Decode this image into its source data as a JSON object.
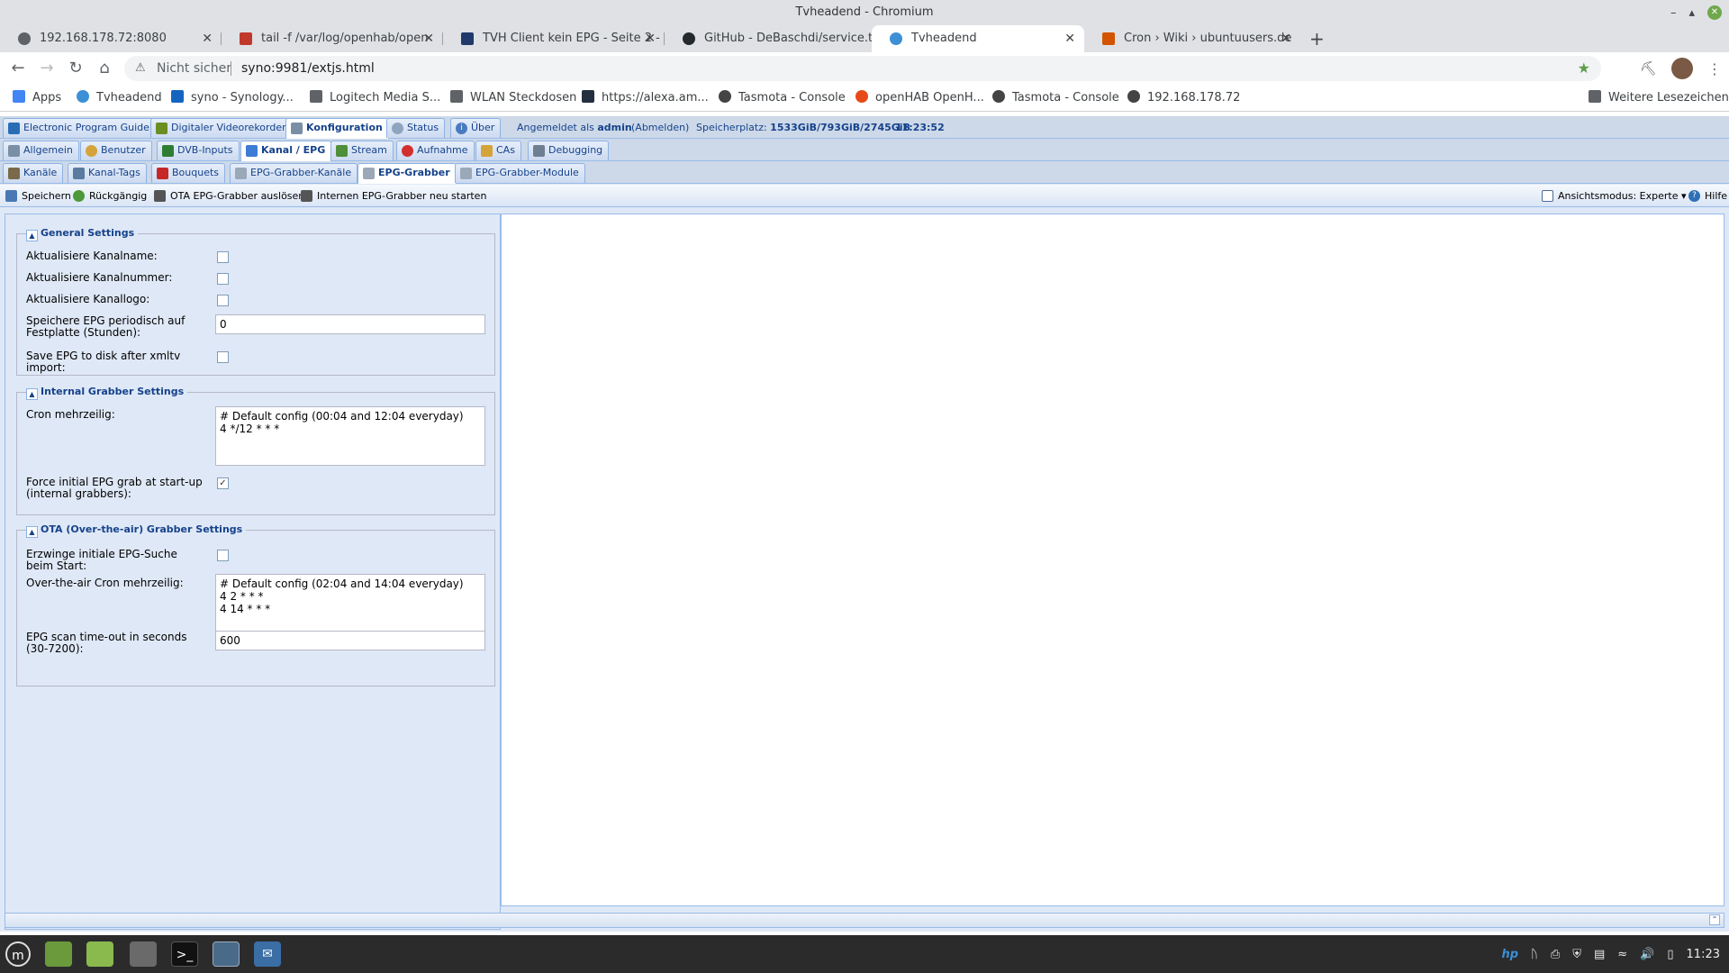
{
  "window": {
    "title": "Tvheadend - Chromium"
  },
  "tabs": [
    {
      "label": "192.168.178.72:8080",
      "icon": "globe-icon"
    },
    {
      "label": "tail -f /var/log/openhab/open",
      "icon": "terminal-log-icon"
    },
    {
      "label": "TVH Client kein EPG - Seite 2 -",
      "icon": "tvh-client-icon"
    },
    {
      "label": "GitHub - DeBaschdi/service.ta",
      "icon": "github-icon"
    },
    {
      "label": "Tvheadend",
      "icon": "tvheadend-icon"
    },
    {
      "label": "Cron › Wiki › ubuntuusers.de",
      "icon": "ubuntuusers-icon"
    }
  ],
  "address": {
    "security": "Nicht sicher",
    "url": "syno:9981/extjs.html"
  },
  "bookmarks": [
    {
      "label": "Apps",
      "icon": "apps-grid-icon"
    },
    {
      "label": "Tvheadend",
      "icon": "tvheadend-icon"
    },
    {
      "label": "syno - Synology...",
      "icon": "dsm-icon"
    },
    {
      "label": "Logitech Media S...",
      "icon": "folder-icon"
    },
    {
      "label": "WLAN Steckdosen",
      "icon": "folder-icon"
    },
    {
      "label": "https://alexa.am...",
      "icon": "amazon-icon"
    },
    {
      "label": "Tasmota - Console",
      "icon": "globe-icon"
    },
    {
      "label": "openHAB OpenH...",
      "icon": "openhab-icon"
    },
    {
      "label": "Tasmota - Console",
      "icon": "globe-icon"
    },
    {
      "label": "192.168.178.72",
      "icon": "globe-icon"
    }
  ],
  "bookmarks_more": "Weitere Lesezeichen",
  "app": {
    "main_tabs": [
      "Electronic Program Guide",
      "Digitaler Videorekorder",
      "Konfiguration",
      "Status",
      "Über"
    ],
    "login_prefix": "Angemeldet als",
    "user": "admin",
    "logout": "(Abmelden)",
    "storage_label": "Speicherplatz:",
    "storage_value": "1533GiB/793GiB/2745GiB",
    "time": "11:23:52",
    "config_tabs": [
      "Allgemein",
      "Benutzer",
      "DVB-Inputs",
      "Kanal / EPG",
      "Stream",
      "Aufnahme",
      "CAs",
      "Debugging"
    ],
    "channel_tabs": [
      "Kanäle",
      "Kanal-Tags",
      "Bouquets",
      "EPG-Grabber-Kanäle",
      "EPG-Grabber",
      "EPG-Grabber-Module"
    ],
    "actions": {
      "save": "Speichern",
      "undo": "Rückgängig",
      "trigger_ota": "OTA EPG-Grabber auslösen",
      "restart_internal": "Internen EPG-Grabber neu starten",
      "view_mode": "Ansichtsmodus: Experte",
      "help": "Hilfe"
    }
  },
  "form": {
    "general": {
      "title": "General Settings",
      "update_name": {
        "label": "Aktualisiere Kanalname:",
        "checked": false
      },
      "update_number": {
        "label": "Aktualisiere Kanalnummer:",
        "checked": false
      },
      "update_logo": {
        "label": "Aktualisiere Kanallogo:",
        "checked": false
      },
      "periodic_save": {
        "label": "Speichere EPG periodisch auf Festplatte (Stunden):",
        "value": "0"
      },
      "save_xmltv": {
        "label": "Save EPG to disk after xmltv import:",
        "checked": false
      }
    },
    "internal": {
      "title": "Internal Grabber Settings",
      "cron": {
        "label": "Cron mehrzeilig:",
        "value": "# Default config (00:04 and 12:04 everyday)\n4 */12 * * *"
      },
      "force_initial": {
        "label": "Force initial EPG grab at start-up (internal grabbers):",
        "checked": true
      }
    },
    "ota": {
      "title": "OTA (Over-the-air) Grabber Settings",
      "force_initial": {
        "label": "Erzwinge initiale EPG-Suche beim Start:",
        "checked": false
      },
      "cron": {
        "label": "Over-the-air Cron mehrzeilig:",
        "value": "# Default config (02:04 and 14:04 everyday)\n4 2 * * *\n4 14 * * *"
      },
      "timeout": {
        "label": "EPG scan time-out in seconds (30-7200):",
        "value": "600"
      }
    }
  },
  "taskbar": {
    "clock": "11:23"
  }
}
